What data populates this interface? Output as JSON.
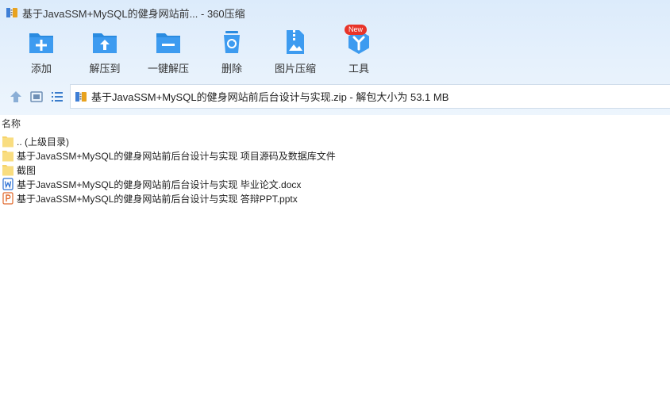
{
  "window": {
    "title": "基于JavaSSM+MySQL的健身网站前... - 360压缩"
  },
  "toolbar": {
    "buttons": [
      {
        "label": "添加",
        "icon": "add-icon"
      },
      {
        "label": "解压到",
        "icon": "extract-to-icon"
      },
      {
        "label": "一键解压",
        "icon": "one-click-extract-icon"
      },
      {
        "label": "删除",
        "icon": "delete-icon"
      },
      {
        "label": "图片压缩",
        "icon": "image-compress-icon"
      },
      {
        "label": "工具",
        "icon": "tools-icon",
        "badge": "New"
      }
    ]
  },
  "nav": {
    "path": "基于JavaSSM+MySQL的健身网站前后台设计与实现.zip - 解包大小为 53.1 MB"
  },
  "list": {
    "column_name": "名称",
    "items": [
      {
        "name": ".. (上级目录)",
        "type": "folder"
      },
      {
        "name": "基于JavaSSM+MySQL的健身网站前后台设计与实现 项目源码及数据库文件",
        "type": "folder"
      },
      {
        "name": "截图",
        "type": "folder"
      },
      {
        "name": "基于JavaSSM+MySQL的健身网站前后台设计与实现 毕业论文.docx",
        "type": "docx"
      },
      {
        "name": "基于JavaSSM+MySQL的健身网站前后台设计与实现 答辩PPT.pptx",
        "type": "pptx"
      }
    ]
  },
  "colors": {
    "accent": "#2a8be0",
    "folder": "#f6d36a",
    "word": "#2b6fd3",
    "ppt": "#e0672a"
  }
}
